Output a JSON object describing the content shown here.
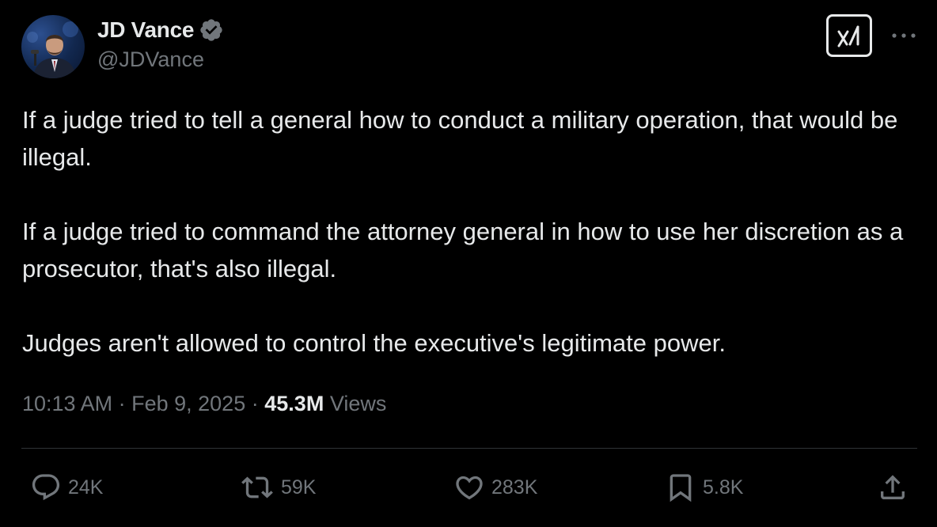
{
  "author": {
    "display_name": "JD Vance",
    "handle": "@JDVance",
    "verified": true,
    "verified_icon": "verified-badge-icon",
    "verified_color": "#71767b"
  },
  "tweet": {
    "paragraphs": [
      "If a judge tried to tell a general how to conduct a military operation, that would be illegal.",
      "If a judge tried to command the attorney general in how to use her discretion as a prosecutor, that's also illegal.",
      "Judges aren't allowed to control the executive's legitimate power."
    ],
    "time": "10:13 AM",
    "date": "Feb 9, 2025",
    "separator": "·",
    "views_count": "45.3M",
    "views_label": "Views"
  },
  "actions": {
    "replies": {
      "icon": "reply-icon",
      "count": "24K"
    },
    "reposts": {
      "icon": "repost-icon",
      "count": "59K"
    },
    "likes": {
      "icon": "heart-icon",
      "count": "283K"
    },
    "bookmarks": {
      "icon": "bookmark-icon",
      "count": "5.8K"
    },
    "share": {
      "icon": "share-icon"
    }
  },
  "header_buttons": {
    "grok": "grok-icon",
    "more": "more-icon"
  },
  "colors": {
    "background": "#000000",
    "text_primary": "#e7e9ea",
    "text_secondary": "#71767b",
    "divider": "#2f3336"
  }
}
